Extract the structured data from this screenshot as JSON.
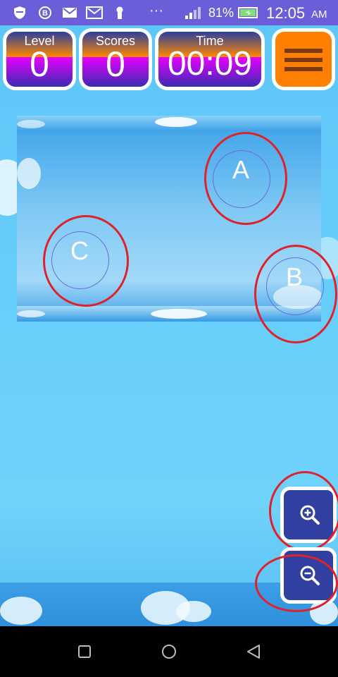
{
  "status_bar": {
    "battery": "81%",
    "time": "12:05",
    "ampm": "AM",
    "dots": "···",
    "icons": [
      "shield-icon",
      "b-icon",
      "mail-icon",
      "mail-icon",
      "key-icon",
      "signal-icon",
      "battery-icon"
    ]
  },
  "hud": {
    "level_label": "Level",
    "level_value": "0",
    "scores_label": "Scores",
    "scores_value": "0",
    "time_label": "Time",
    "time_value": "00:09"
  },
  "markers": {
    "a": "A",
    "b": "B",
    "c": "C"
  },
  "colors": {
    "status_bar": "#6a5fd8",
    "menu_button": "#ff7f00",
    "zoom_button": "#303fa0",
    "highlight_ring": "#e0202a"
  },
  "nav_icons": [
    "recent-apps-icon",
    "home-icon",
    "back-icon"
  ]
}
